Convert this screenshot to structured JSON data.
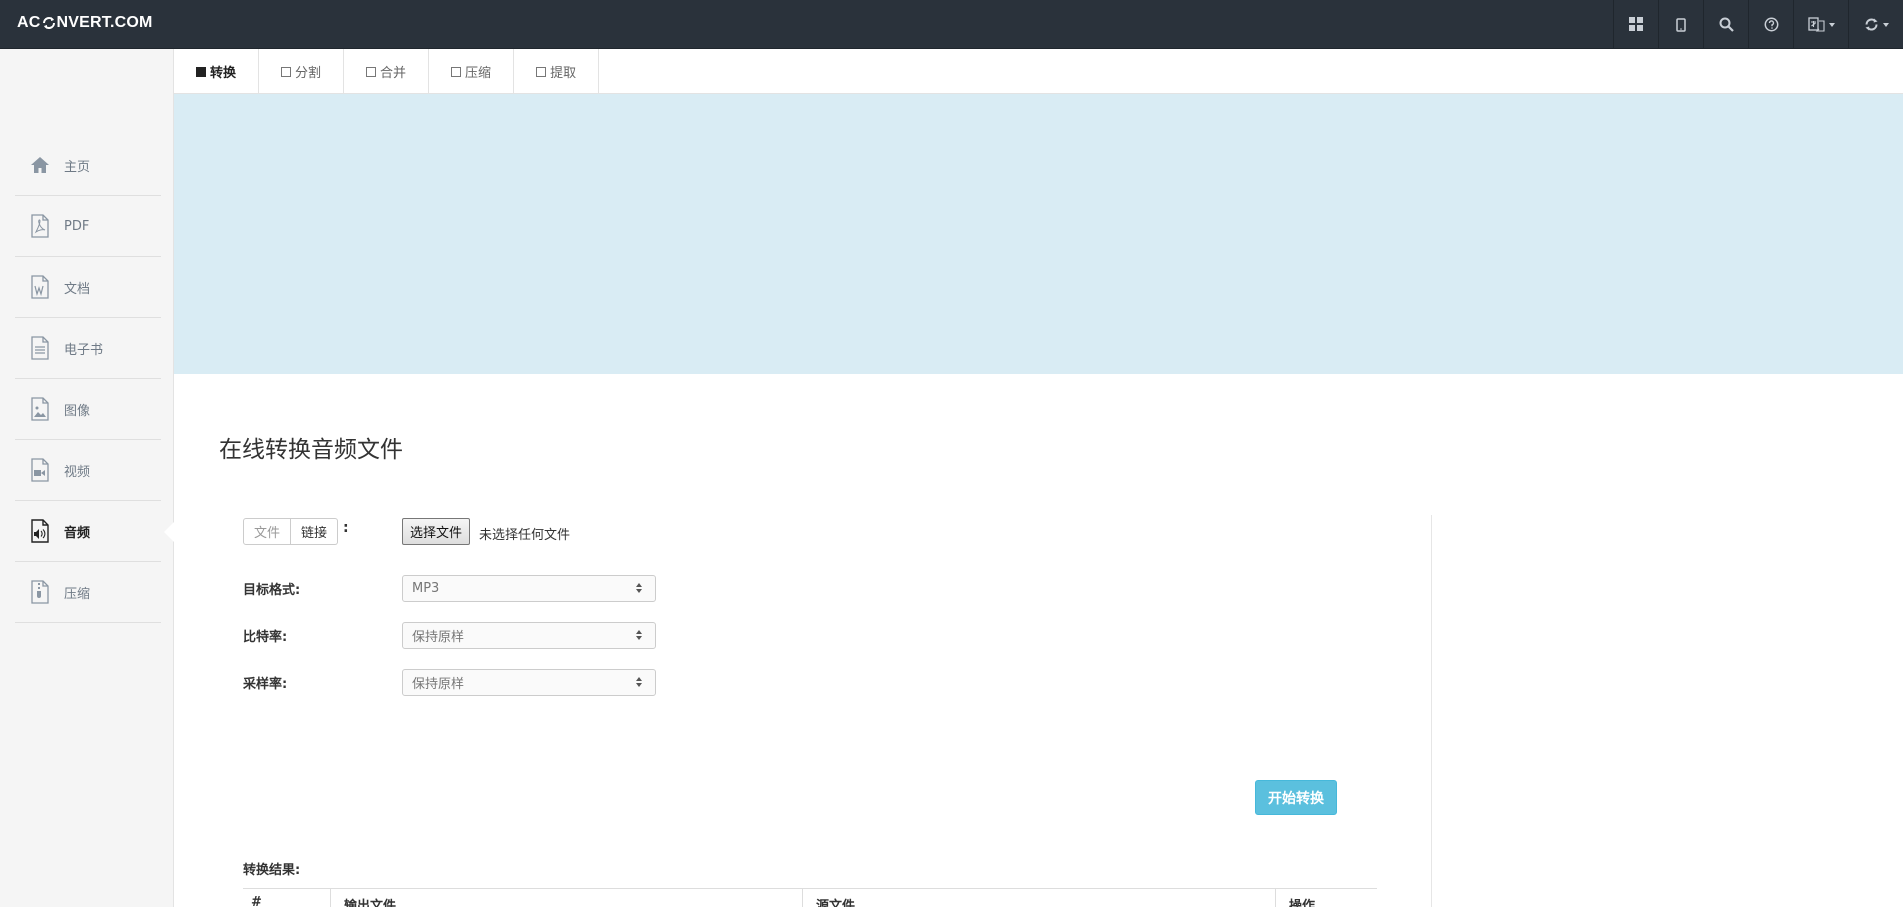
{
  "brand": {
    "name_left": "AC",
    "name_right": "NVERT.COM"
  },
  "topnav": {
    "icons": [
      "grid-icon",
      "mobile-icon",
      "search-icon",
      "help-icon",
      "language-icon",
      "refresh-icon"
    ]
  },
  "sidebar": {
    "items": [
      {
        "label": "主页",
        "icon": "home-icon"
      },
      {
        "label": "PDF",
        "icon": "pdf-file-icon"
      },
      {
        "label": "文档",
        "icon": "word-file-icon"
      },
      {
        "label": "电子书",
        "icon": "text-file-icon"
      },
      {
        "label": "图像",
        "icon": "image-file-icon"
      },
      {
        "label": "视频",
        "icon": "video-file-icon"
      },
      {
        "label": "音频",
        "icon": "audio-file-icon",
        "active": true
      },
      {
        "label": "压缩",
        "icon": "archive-file-icon"
      }
    ]
  },
  "tabs": [
    {
      "label": "转换",
      "active": true
    },
    {
      "label": "分割"
    },
    {
      "label": "合并"
    },
    {
      "label": "压缩"
    },
    {
      "label": "提取"
    }
  ],
  "main": {
    "title": "在线转换音频文件",
    "source": {
      "file_tab": "文件",
      "link_tab": "链接",
      "colon": ":",
      "choose_button": "选择文件",
      "no_file": "未选择任何文件"
    },
    "fields": {
      "format": {
        "label": "目标格式:",
        "value": "MP3"
      },
      "bitrate": {
        "label": "比特率:",
        "value": "保持原样"
      },
      "samplerate": {
        "label": "采样率:",
        "value": "保持原样"
      }
    },
    "convert_button": "开始转换",
    "results": {
      "label": "转换结果:",
      "headers": [
        "#",
        "输出文件",
        "源文件",
        "操作"
      ]
    }
  },
  "colors": {
    "topbar": "#2a323b",
    "banner": "#d9ecf4",
    "accent": "#5bc0de",
    "sidebar_bg": "#f5f5f5"
  }
}
